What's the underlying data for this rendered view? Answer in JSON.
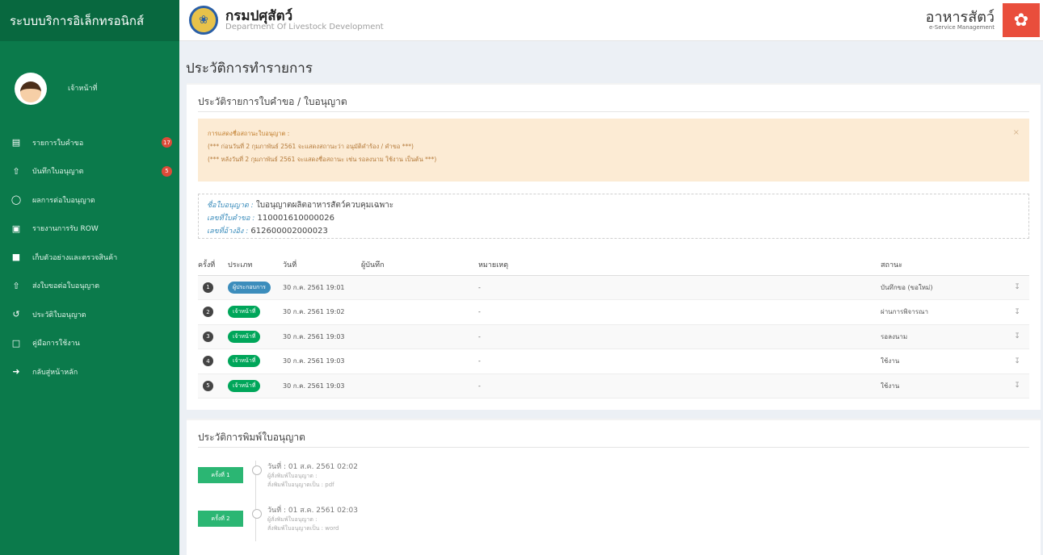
{
  "sidebar": {
    "brand": "ระบบบริการอิเล็กทรอนิกส์",
    "user": {
      "name": "",
      "role": "เจ้าหน้าที่"
    },
    "items": [
      {
        "label": "รายการใบคำขอ",
        "icon": "document-icon",
        "badge": "17"
      },
      {
        "label": "บันทึกใบอนุญาต",
        "icon": "upload-icon",
        "badge": "5"
      },
      {
        "label": "ผลการต่อใบอนุญาต",
        "icon": "comment-icon",
        "badge": ""
      },
      {
        "label": "รายงานการรับ ROW",
        "icon": "cart-icon",
        "badge": ""
      },
      {
        "label": "เก็บตัวอย่างและตรวจสินค้า",
        "icon": "box-icon",
        "badge": ""
      },
      {
        "label": "ส่งใบขอต่อใบอนุญาต",
        "icon": "upload-icon",
        "badge": ""
      },
      {
        "label": "ประวัติใบอนุญาต",
        "icon": "history-icon",
        "badge": ""
      },
      {
        "label": "คู่มือการใช้งาน",
        "icon": "pdf-icon",
        "badge": ""
      },
      {
        "label": "กลับสู่หน้าหลัก",
        "icon": "signout-icon",
        "badge": ""
      }
    ]
  },
  "header": {
    "dept_name": "กรมปศุสัตว์",
    "dept_sub": "Department Of Livestock Development",
    "app_title": "อาหารสัตว์",
    "app_sub": "e-Service Management"
  },
  "page_title": "ประวัติการทำรายการ",
  "history_panel": {
    "title": "ประวัติรายการใบคำขอ / ใบอนุญาต",
    "notice": {
      "title": "การแสดงชื่อสถานะใบอนุญาต :",
      "line1": "(*** ก่อนวันที่ 2 กุมภาพันธ์ 2561 จะแสดงสถานะว่า อนุมัติคำร้อง / คำขอ ***)",
      "line2": "(*** หลังวันที่ 2 กุมภาพันธ์ 2561 จะแสดงชื่อสถานะ เช่น รอลงนาม ใช้งาน เป็นต้น ***)"
    },
    "info": {
      "license_name_label": "ชื่อใบอนุญาต :",
      "license_name_value": "ใบอนุญาตผลิตอาหารสัตว์ควบคุมเฉพาะ",
      "request_no_label": "เลขที่ใบคำขอ :",
      "request_no_value": "110001610000026",
      "ref_no_label": "เลขที่อ้างอิง :",
      "ref_no_value": "612600002000023"
    },
    "columns": [
      "ครั้งที่",
      "ประเภท",
      "วันที่",
      "ผู้บันทึก",
      "หมายเหตุ",
      "สถานะ"
    ],
    "rows": [
      {
        "no": "1",
        "type": "ผู้ประกอบการ",
        "type_style": "blue",
        "date": "30 ก.ค. 2561 19:01",
        "recorder": "",
        "note": "-",
        "status": "บันทึกขอ (ขอใหม่)"
      },
      {
        "no": "2",
        "type": "เจ้าหน้าที่",
        "type_style": "green",
        "date": "30 ก.ค. 2561 19:02",
        "recorder": "",
        "note": "-",
        "status": "ผ่านการพิจารณา"
      },
      {
        "no": "3",
        "type": "เจ้าหน้าที่",
        "type_style": "green",
        "date": "30 ก.ค. 2561 19:03",
        "recorder": "",
        "note": "-",
        "status": "รอลงนาม"
      },
      {
        "no": "4",
        "type": "เจ้าหน้าที่",
        "type_style": "green",
        "date": "30 ก.ค. 2561 19:03",
        "recorder": "",
        "note": "-",
        "status": "ใช้งาน"
      },
      {
        "no": "5",
        "type": "เจ้าหน้าที่",
        "type_style": "green",
        "date": "30 ก.ค. 2561 19:03",
        "recorder": "",
        "note": "-",
        "status": "ใช้งาน"
      }
    ]
  },
  "print_panel": {
    "title": "ประวัติการพิมพ์ใบอนุญาต",
    "entries": [
      {
        "button": "ครั้งที่ 1",
        "date_line": "วันที่ : 01 ส.ค. 2561 02:02",
        "printer_label": "ผู้สั่งพิมพ์ใบอนุญาต :",
        "format_line": "สั่งพิมพ์ใบอนุญาตเป็น : pdf"
      },
      {
        "button": "ครั้งที่ 2",
        "date_line": "วันที่ : 01 ส.ค. 2561 02:03",
        "printer_label": "ผู้สั่งพิมพ์ใบอนุญาต :",
        "format_line": "สั่งพิมพ์ใบอนุญาตเป็น : word"
      }
    ]
  },
  "colors": {
    "sidebar": "#0b7a4b",
    "accent_red": "#e94e3c",
    "badge": "#dd4b39",
    "tag_blue": "#3c8dbc",
    "tag_green": "#00a65a",
    "print_btn": "#2bb673"
  }
}
